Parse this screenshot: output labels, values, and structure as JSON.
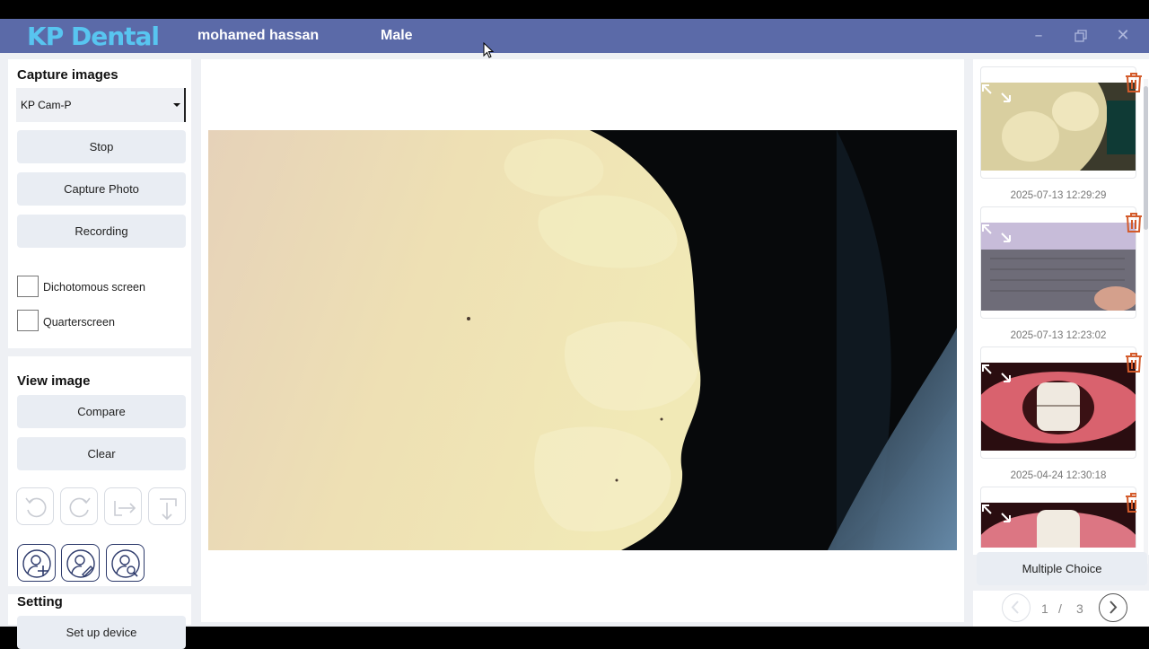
{
  "titlebar": {
    "logo": "KP Dental",
    "patient_name": "mohamed hassan",
    "patient_gender": "Male",
    "minimize_icon": "minimize-icon",
    "maximize_icon": "maximize-icon",
    "close_icon": "close-icon"
  },
  "capture": {
    "title": "Capture images",
    "camera_selected": "KP Cam-P",
    "stop_label": "Stop",
    "capture_photo_label": "Capture Photo",
    "recording_label": "Recording",
    "dichotomous_label": "Dichotomous screen",
    "quarterscreen_label": "Quarterscreen",
    "dichotomous_checked": false,
    "quarterscreen_checked": false
  },
  "view": {
    "title": "View image",
    "compare_label": "Compare",
    "clear_label": "Clear",
    "tools": [
      "rotate-left-icon",
      "rotate-right-icon",
      "flip-horizontal-icon",
      "flip-vertical-icon"
    ],
    "patient_tools": [
      "add-patient-icon",
      "edit-patient-icon",
      "search-patient-icon"
    ]
  },
  "setting": {
    "title": "Setting",
    "setup_label": "Set up device"
  },
  "gallery": {
    "items": [
      {
        "date": "2025-07-13 12:29:29",
        "kind": "teeth-model"
      },
      {
        "date": "2025-07-13 12:23:02",
        "kind": "laptop"
      },
      {
        "date": "2025-04-24 12:30:18",
        "kind": "mouth"
      },
      {
        "date": "",
        "kind": "mouth"
      }
    ],
    "multiple_choice_label": "Multiple Choice",
    "page_current": "1",
    "page_separator": "/",
    "page_total": "3"
  },
  "colors": {
    "titlebar": "#5b6aa8",
    "logo": "#58c5f0",
    "trash": "#d35b2b",
    "button_bg": "#e9edf3"
  }
}
